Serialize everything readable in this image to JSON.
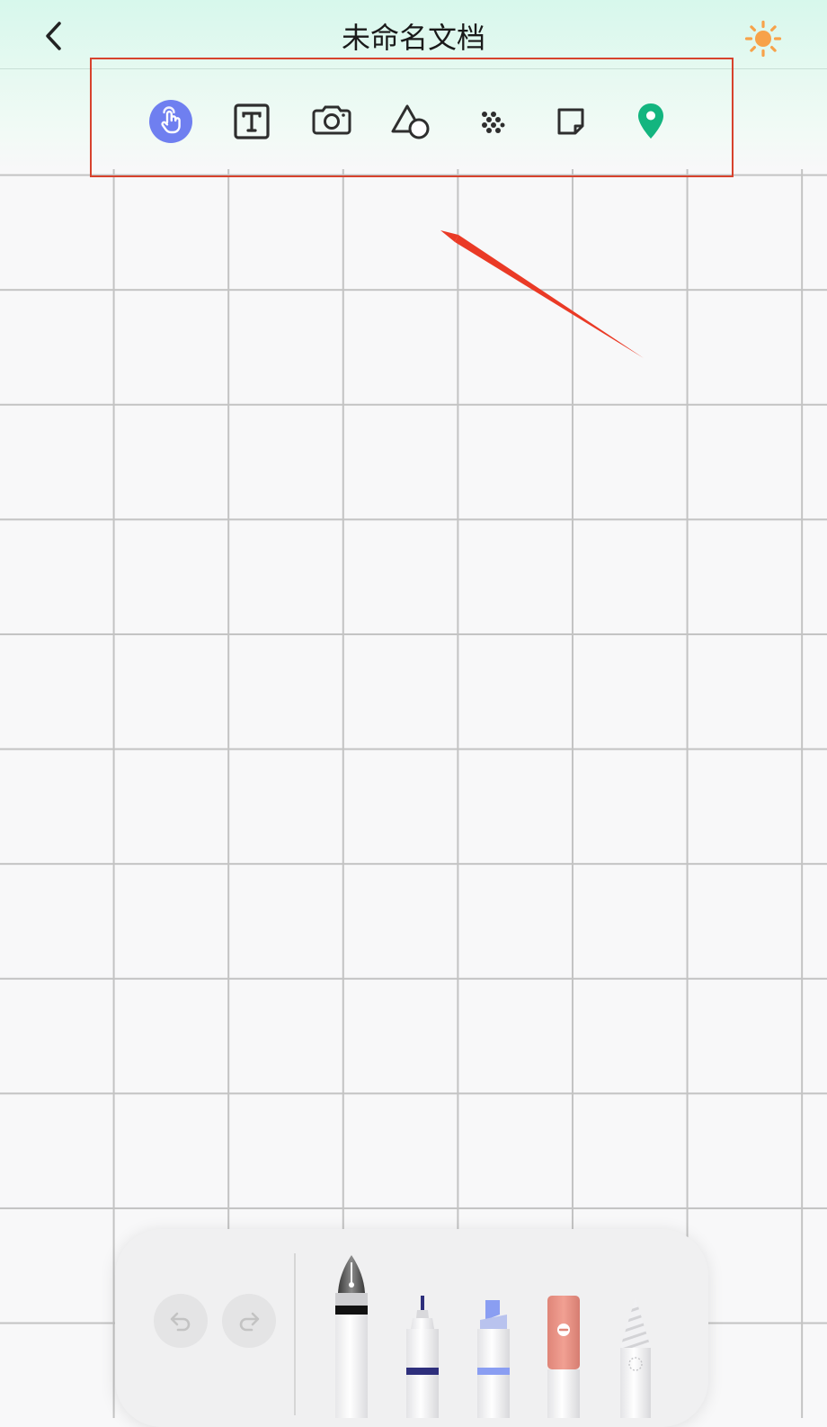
{
  "header": {
    "title": "未命名文档",
    "back_icon": "chevron-left-icon",
    "theme_icon": "sun-icon"
  },
  "toolbar": {
    "tools": [
      {
        "name": "hand",
        "icon": "hand-pointer-icon",
        "selected": true
      },
      {
        "name": "text",
        "icon": "text-box-icon",
        "selected": false
      },
      {
        "name": "camera",
        "icon": "camera-icon",
        "selected": false
      },
      {
        "name": "shapes",
        "icon": "shapes-icon",
        "selected": false
      },
      {
        "name": "dots",
        "icon": "dots-grid-icon",
        "selected": false
      },
      {
        "name": "sticky-note",
        "icon": "sticky-note-icon",
        "selected": false
      },
      {
        "name": "location",
        "icon": "location-pin-icon",
        "selected": false
      }
    ]
  },
  "dock": {
    "undo_icon": "undo-icon",
    "redo_icon": "redo-icon",
    "pens": [
      {
        "name": "fountain-pen",
        "icon": "fountain-pen-icon",
        "selected": true
      },
      {
        "name": "fineliner",
        "icon": "fineliner-icon",
        "selected": false
      },
      {
        "name": "highlighter",
        "icon": "highlighter-icon",
        "selected": false
      },
      {
        "name": "eraser",
        "icon": "eraser-icon",
        "selected": false
      },
      {
        "name": "pencil",
        "icon": "pencil-icon",
        "selected": false
      }
    ]
  },
  "colors": {
    "accent": "#6f7ff0",
    "highlight_box": "#d7422d",
    "location_pin": "#13b57f",
    "sun": "#f7a24a",
    "eraser": "#e99286",
    "fineliner_band": "#2e2f7c",
    "highlighter_tip": "#8a9ef2"
  }
}
